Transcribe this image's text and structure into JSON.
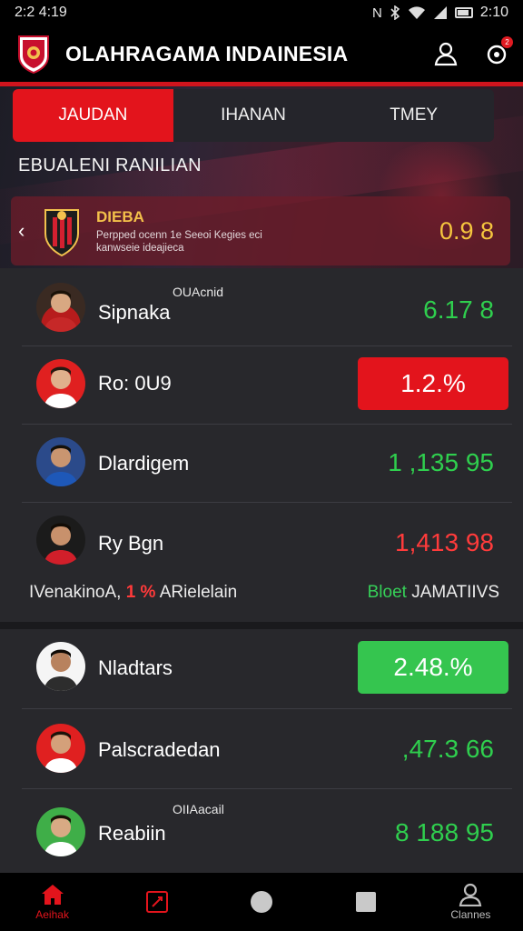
{
  "status_bar": {
    "left_time": "2:2 4:19",
    "right_time": "2:10",
    "icons": [
      "nfc-icon",
      "bluetooth-icon",
      "wifi-icon",
      "signal-icon",
      "battery-icon"
    ]
  },
  "header": {
    "title": "OLAHRAGAMA INDAINESIA",
    "icons": [
      "logo-shield-icon",
      "profile-icon",
      "notifications-icon"
    ],
    "notification_badge": "2"
  },
  "tabs": [
    {
      "label": "JAUDAN",
      "active": true
    },
    {
      "label": "IHANAN",
      "active": false
    },
    {
      "label": "TMEY",
      "active": false
    }
  ],
  "section_title": "EBUALENI RANILIAN",
  "featured": {
    "name": "DIEBA",
    "description": "Perpped ocenn 1e Seeoi Kegies eci kanwseie ideajieca",
    "value": "0.9  8"
  },
  "players": [
    {
      "name": "Sipnaka",
      "label": "OUAcnid",
      "value": "6.17  8",
      "color": "#2fcf4e",
      "style": "text"
    },
    {
      "name": "Ro: 0U9",
      "label": "",
      "value": "1.2.%",
      "color": "#e3141c",
      "style": "pill"
    },
    {
      "name": "Dlardigem",
      "label": "",
      "value": "1 ,135 95",
      "color": "#2fcf4e",
      "style": "text"
    },
    {
      "name": "Ry Bgn",
      "label": "",
      "value": "1,413 98",
      "color": "#ff3b3b",
      "style": "text"
    },
    {
      "name": "Nladtars",
      "label": "",
      "value": "2.48.%",
      "color": "#35c54f",
      "style": "pill"
    },
    {
      "name": "Palscradedan",
      "label": "",
      "value": ",47.3 66",
      "color": "#2fcf4e",
      "style": "text"
    },
    {
      "name": "Reabiin",
      "label": "OIIAacail",
      "value": "8   188 95",
      "color": "#2fcf4e",
      "style": "text"
    }
  ],
  "info_line": {
    "prefix": "IVenakinoA,",
    "highlight": "1 %",
    "suffix": "ARielelain",
    "right_green": "Bloet",
    "right_text": "JAMATIIVS"
  },
  "bottom_nav": [
    {
      "icon": "home-icon",
      "label": "Aeihak",
      "active": true
    },
    {
      "icon": "scores-icon",
      "label": "",
      "active": false
    },
    {
      "icon": "circle-icon",
      "label": "",
      "active": false
    },
    {
      "icon": "square-icon",
      "label": "",
      "active": false
    },
    {
      "icon": "person-icon",
      "label": "Clannes",
      "active": false
    }
  ],
  "colors": {
    "accent_red": "#e3141c",
    "positive_green": "#2fcf4e",
    "gold": "#f5c53e"
  }
}
